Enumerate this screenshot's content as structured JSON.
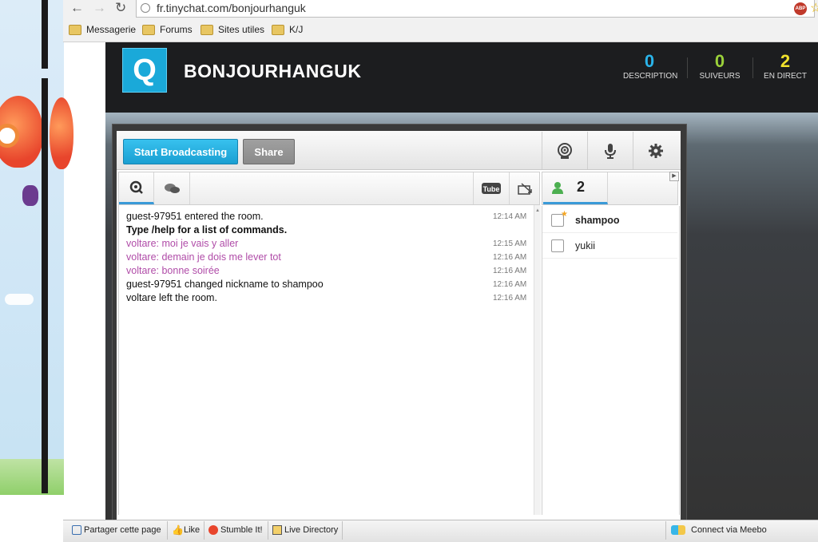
{
  "browser": {
    "url": "fr.tinychat.com/bonjourhanguk",
    "bookmarks": [
      "Messagerie",
      "Forums",
      "Sites utiles",
      "K/J"
    ]
  },
  "header": {
    "logo_letter": "Q",
    "room_name": "BONJOURHANGUK",
    "stats": [
      {
        "value": "0",
        "label": "DESCRIPTION",
        "color": "#2ab4ea"
      },
      {
        "value": "0",
        "label": "SUIVEURS",
        "color": "#9bd13a"
      },
      {
        "value": "2",
        "label": "EN DIRECT",
        "color": "#f1e12c"
      }
    ]
  },
  "toolbar": {
    "broadcast_label": "Start Broadcasting",
    "share_label": "Share"
  },
  "chat": {
    "messages": [
      {
        "text": "guest-97951 entered the room.",
        "time": "12:14 AM",
        "style": "normal"
      },
      {
        "text": "Type /help for a list of commands.",
        "time": "",
        "style": "bold"
      },
      {
        "text": "voltare: moi je vais y aller",
        "time": "12:15 AM",
        "style": "purple"
      },
      {
        "text": "voltare: demain je dois me lever tot",
        "time": "12:16 AM",
        "style": "purple"
      },
      {
        "text": "voltare: bonne soirée",
        "time": "12:16 AM",
        "style": "purple"
      },
      {
        "text": "guest-97951 changed nickname to shampoo",
        "time": "12:16 AM",
        "style": "normal"
      },
      {
        "text": "voltare left the room.",
        "time": "12:16 AM",
        "style": "normal"
      }
    ]
  },
  "users": {
    "count": "2",
    "list": [
      {
        "name": "shampoo",
        "bold": true
      },
      {
        "name": "yukii",
        "bold": false
      }
    ]
  },
  "bottom_bar": {
    "share_page": "Partager cette page",
    "like": "Like",
    "stumble": "Stumble It!",
    "live_directory": "Live Directory",
    "meebo": "Connect via Meebo"
  }
}
